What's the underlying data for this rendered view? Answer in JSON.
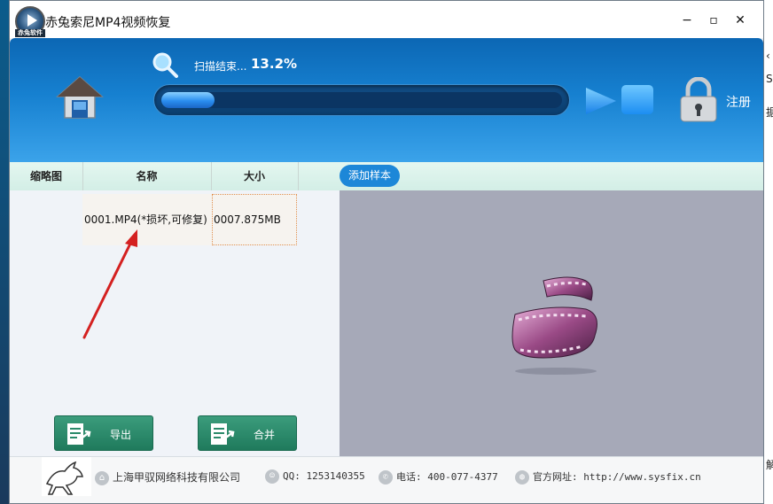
{
  "window": {
    "title": "赤兔索尼MP4视频恢复",
    "logo_caption": "赤兔软件",
    "controls": {
      "minimize": "−",
      "maximize": "▫",
      "close": "✕"
    }
  },
  "header": {
    "scan_label": "扫描结束...",
    "scan_percent": "13.2%",
    "progress": 0.132,
    "register_label": "注册"
  },
  "columns": {
    "thumbnail": "缩略图",
    "name": "名称",
    "size": "大小",
    "add_sample": "添加样本"
  },
  "files": [
    {
      "name": "0001.MP4(*损坏,可修复)",
      "size": "0007.875MB"
    }
  ],
  "actions": {
    "export": "导出",
    "merge": "合并"
  },
  "footer": {
    "company": "上海甲驭网络科技有限公司",
    "qq": "QQ: 1253140355",
    "phone": "电话: 400-077-4377",
    "website": "官方网址: http://www.sysfix.cn"
  },
  "background_fragments": [
    "‹",
    "S",
    "据",
    "解"
  ],
  "colors": {
    "header_blue": "#1680d0",
    "button_green": "#2a8a6a",
    "accent_blue": "#1d87d8",
    "preview_gray": "#a6a9b8",
    "annotation_red": "#d42020"
  }
}
